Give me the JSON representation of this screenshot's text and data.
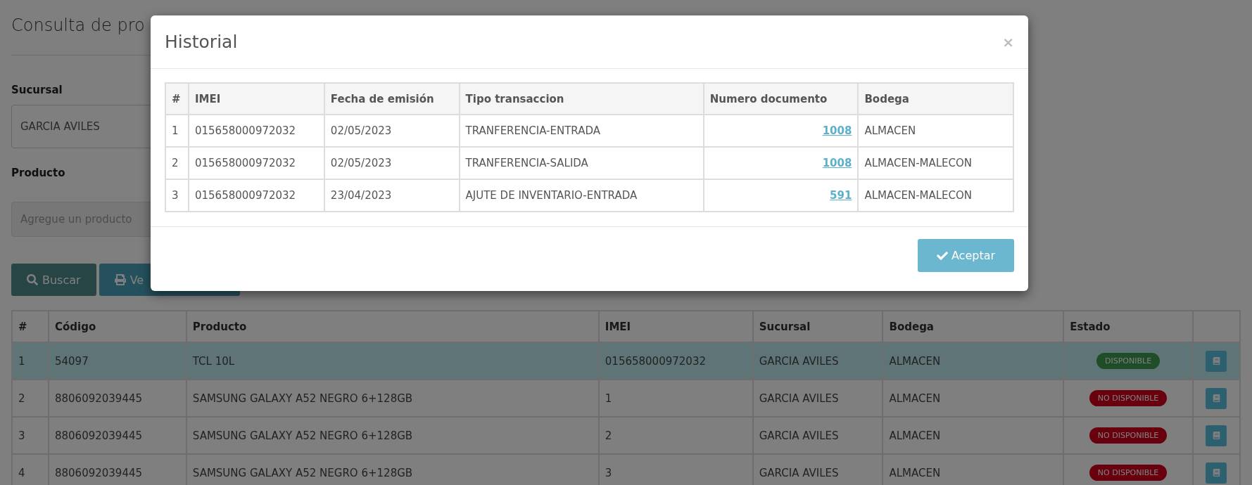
{
  "page": {
    "title": "Consulta de pro"
  },
  "form": {
    "sucursal_label": "Sucursal",
    "sucursal_value": "GARCIA AVILES",
    "producto_label": "Producto",
    "producto_placeholder": "Agregue un producto"
  },
  "buttons": [
    {
      "kind": "search",
      "label": "Buscar"
    },
    {
      "kind": "print",
      "label": "Ve"
    }
  ],
  "table": {
    "columns": [
      "#",
      "Código",
      "Producto",
      "IMEI",
      "Sucursal",
      "Bodega",
      "Estado"
    ],
    "rows": [
      {
        "n": "1",
        "code": "54097",
        "product": "TCL 10L",
        "imei": "015658000972032",
        "branch": "GARCIA AVILES",
        "warehouse": "ALMACEN",
        "status": "DISPONIBLE",
        "available": true,
        "selected": true
      },
      {
        "n": "2",
        "code": "8806092039445",
        "product": "SAMSUNG GALAXY A52 NEGRO 6+128GB",
        "imei": "1",
        "branch": "GARCIA AVILES",
        "warehouse": "ALMACEN",
        "status": "NO DISPONIBLE",
        "available": false,
        "selected": false
      },
      {
        "n": "3",
        "code": "8806092039445",
        "product": "SAMSUNG GALAXY A52 NEGRO 6+128GB",
        "imei": "2",
        "branch": "GARCIA AVILES",
        "warehouse": "ALMACEN",
        "status": "NO DISPONIBLE",
        "available": false,
        "selected": false
      },
      {
        "n": "4",
        "code": "8806092039445",
        "product": "SAMSUNG GALAXY A52 NEGRO 6+128GB",
        "imei": "3",
        "branch": "GARCIA AVILES",
        "warehouse": "ALMACEN",
        "status": "NO DISPONIBLE",
        "available": false,
        "selected": false
      }
    ]
  },
  "modal": {
    "title": "Historial",
    "close": "×",
    "columns": [
      "#",
      "IMEI",
      "Fecha de emisión",
      "Tipo transaccion",
      "Numero documento",
      "Bodega"
    ],
    "rows": [
      {
        "n": "1",
        "imei": "015658000972032",
        "date": "02/05/2023",
        "type": "TRANFERENCIA-ENTRADA",
        "doc": "1008",
        "warehouse": "ALMACEN"
      },
      {
        "n": "2",
        "imei": "015658000972032",
        "date": "02/05/2023",
        "type": "TRANFERENCIA-SALIDA",
        "doc": "1008",
        "warehouse": "ALMACEN-MALECON"
      },
      {
        "n": "3",
        "imei": "015658000972032",
        "date": "23/04/2023",
        "type": "AJUTE DE INVENTARIO-ENTRADA",
        "doc": "591",
        "warehouse": "ALMACEN-MALECON"
      }
    ],
    "accept": "Aceptar"
  }
}
